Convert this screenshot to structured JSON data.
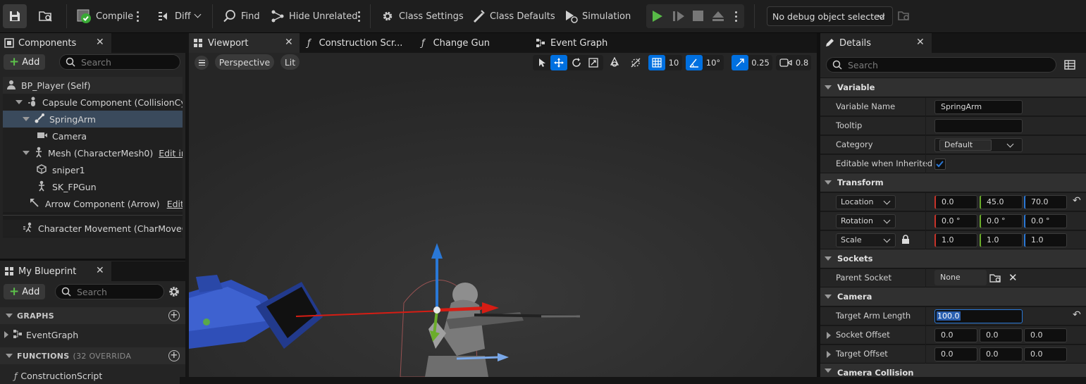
{
  "toolbar": {
    "compile_label": "Compile",
    "diff_label": "Diff",
    "find_label": "Find",
    "hide_unrelated_label": "Hide Unrelated",
    "class_settings_label": "Class Settings",
    "class_defaults_label": "Class Defaults",
    "simulation_label": "Simulation",
    "debug_select_value": "No debug object selected"
  },
  "components": {
    "tab_label": "Components",
    "add_label": "Add",
    "search_placeholder": "Search",
    "tree": [
      {
        "label": "BP_Player (Self)",
        "icon": "person-icon"
      },
      {
        "label": "Capsule Component (CollisionCylinder)",
        "icon": "capsule-icon"
      },
      {
        "label": "SpringArm",
        "icon": "springarm-icon"
      },
      {
        "label": "Camera",
        "icon": "camera-icon"
      },
      {
        "label": "Mesh (CharacterMesh0)",
        "icon": "skeleton-icon",
        "link": "Edit in C++"
      },
      {
        "label": "sniper1",
        "icon": "cube-icon"
      },
      {
        "label": "SK_FPGun",
        "icon": "skeleton-icon"
      },
      {
        "label": "Arrow Component (Arrow)",
        "icon": "arrow-icon",
        "link": "Edit in C++"
      },
      {
        "label": "Character Movement (CharMoveComp)",
        "icon": "movement-icon"
      }
    ]
  },
  "my_blueprint": {
    "tab_label": "My Blueprint",
    "add_label": "Add",
    "search_placeholder": "Search",
    "graphs_header": "GRAPHS",
    "event_graph_item": "EventGraph",
    "functions_header": "FUNCTIONS",
    "functions_count": "(32 OVERRIDA",
    "construction_item": "ConstructionScript"
  },
  "tabs": {
    "viewport": "Viewport",
    "construction": "Construction Scr...",
    "change_gun": "Change Gun",
    "event_graph": "Event Graph"
  },
  "viewport": {
    "perspective_label": "Perspective",
    "lit_label": "Lit",
    "grid_snap": "10",
    "rotation_snap": "10°",
    "scale_snap": "0.25",
    "camera_speed": "0.8"
  },
  "details": {
    "tab_label": "Details",
    "search_placeholder": "Search",
    "variable_header": "Variable",
    "variable_name_label": "Variable Name",
    "variable_name_value": "SpringArm",
    "tooltip_label": "Tooltip",
    "tooltip_value": "",
    "category_label": "Category",
    "category_value": "Default",
    "editable_label": "Editable when Inherited",
    "editable_checked": true,
    "transform_header": "Transform",
    "location_label": "Location",
    "location": [
      "0.0",
      "45.0",
      "70.0"
    ],
    "rotation_label": "Rotation",
    "rotation": [
      "0.0 °",
      "0.0 °",
      "0.0 °"
    ],
    "scale_label": "Scale",
    "scale": [
      "1.0",
      "1.0",
      "1.0"
    ],
    "sockets_header": "Sockets",
    "parent_socket_label": "Parent Socket",
    "parent_socket_value": "None",
    "camera_header": "Camera",
    "target_arm_length_label": "Target Arm Length",
    "target_arm_length_value": "100.0",
    "socket_offset_label": "Socket Offset",
    "socket_offset": [
      "0.0",
      "0.0",
      "0.0"
    ],
    "target_offset_label": "Target Offset",
    "target_offset": [
      "0.0",
      "0.0",
      "0.0"
    ],
    "camera_collision_header": "Camera Collision"
  },
  "colors": {
    "accent_blue": "#0070e0",
    "play_green": "#58b947",
    "selection_row": "#3a4a5c"
  }
}
